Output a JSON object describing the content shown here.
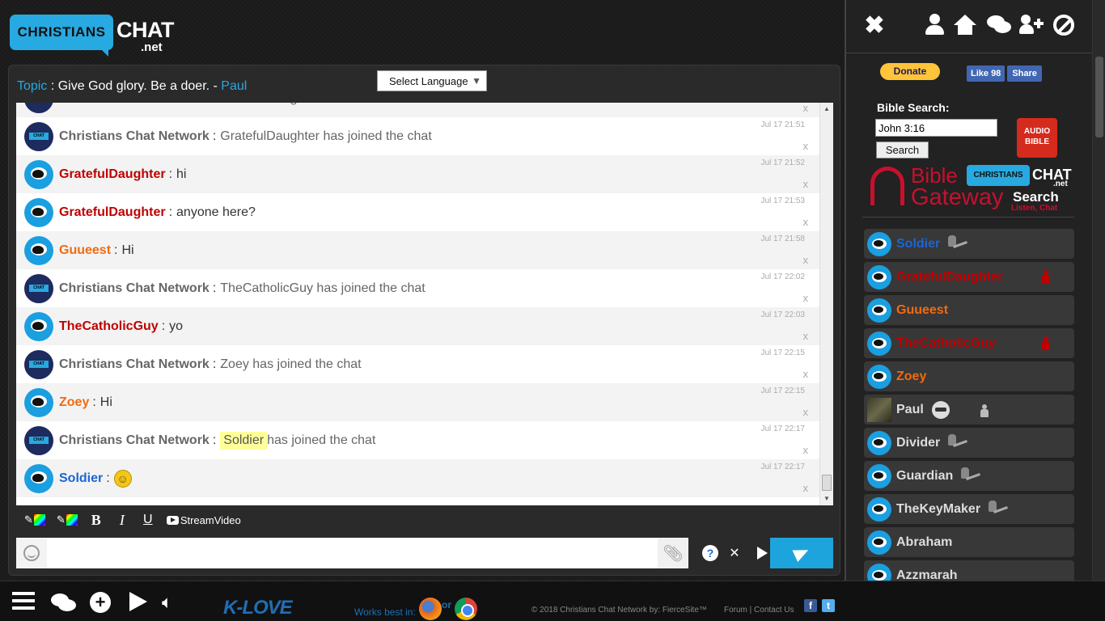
{
  "logo": {
    "box_text": "CHRISTIANS",
    "chat_text": "CHAT",
    "net_text": ".net"
  },
  "topic": {
    "label": "Topic",
    "separator": ":",
    "text": "Give God glory. Be a doer. - ",
    "author": "Paul"
  },
  "language_select": {
    "label": "Select Language",
    "arrow": "▼"
  },
  "messages": [
    {
      "avatar": "sys",
      "name": "Christians Chat Network",
      "name_color": "sys",
      "text": "GratefulDaughter has left the chat",
      "time": "",
      "system": true
    },
    {
      "avatar": "sys",
      "name": "Christians Chat Network",
      "name_color": "sys",
      "text": "GratefulDaughter has joined the chat",
      "time": "Jul 17 21:51",
      "system": true
    },
    {
      "avatar": "user",
      "name": "GratefulDaughter",
      "name_color": "red",
      "text": "hi",
      "time": "Jul 17 21:52",
      "system": false
    },
    {
      "avatar": "user",
      "name": "GratefulDaughter",
      "name_color": "red",
      "text": "anyone here?",
      "time": "Jul 17 21:53",
      "system": false
    },
    {
      "avatar": "user",
      "name": "Guueest",
      "name_color": "orange",
      "text": "Hi",
      "time": "Jul 17 21:58",
      "system": false
    },
    {
      "avatar": "sys",
      "name": "Christians Chat Network",
      "name_color": "sys",
      "text": "TheCatholicGuy has joined the chat",
      "time": "Jul 17 22:02",
      "system": true
    },
    {
      "avatar": "user",
      "name": "TheCatholicGuy",
      "name_color": "red",
      "text": "yo",
      "time": "Jul 17 22:03",
      "system": false
    },
    {
      "avatar": "sys",
      "name": "Christians Chat Network",
      "name_color": "sys",
      "text": "Zoey has joined the chat",
      "time": "Jul 17 22:15",
      "system": true
    },
    {
      "avatar": "user",
      "name": "Zoey",
      "name_color": "orange",
      "text": "Hi",
      "time": "Jul 17 22:15",
      "system": false
    },
    {
      "avatar": "sys",
      "name": "Christians Chat Network",
      "name_color": "sys",
      "highlight": "Soldier",
      "text": "has joined the chat",
      "time": "Jul 17 22:17",
      "system": true
    },
    {
      "avatar": "user",
      "name": "Soldier",
      "name_color": "blue",
      "text": "",
      "smiley": true,
      "time": "Jul 17 22:17",
      "system": false
    }
  ],
  "message_delete": "x",
  "format_bar": {
    "bold": "B",
    "italic": "I",
    "underline": "U",
    "stream_video": "StreamVideo"
  },
  "input": {
    "value": "",
    "placeholder": ""
  },
  "help_label": "?",
  "sidebar": {
    "close": "✖",
    "donate": "Donate",
    "fb_like": "Like 98",
    "fb_share": "Share",
    "bible_search_label": "Bible Search:",
    "bible_search_value": "John 3:16",
    "bible_search_button": "Search",
    "audio_bible": "AUDIO BIBLE",
    "bg_bible": "Bible",
    "bg_gateway": "Gateway",
    "bg_chat_box": "CHRISTIANS",
    "bg_chat": "CHAT",
    "bg_net": ".net",
    "bg_search": "Search",
    "bg_listen": "Listen, Chat",
    "users": [
      {
        "name": "Soldier",
        "color": "blue",
        "badge": "knight"
      },
      {
        "name": "GratefulDaughter",
        "color": "red",
        "badge": "person-red"
      },
      {
        "name": "Guueest",
        "color": "orange",
        "badge": ""
      },
      {
        "name": "TheCatholicGuy",
        "color": "red",
        "badge": "person-red"
      },
      {
        "name": "Zoey",
        "color": "orange",
        "badge": ""
      },
      {
        "name": "Paul",
        "color": "grey",
        "badge": "robot",
        "photo": true
      },
      {
        "name": "Divider",
        "color": "grey",
        "badge": "knight"
      },
      {
        "name": "Guardian",
        "color": "grey",
        "badge": "knight"
      },
      {
        "name": "TheKeyMaker",
        "color": "grey",
        "badge": "knight"
      },
      {
        "name": "Abraham",
        "color": "grey",
        "badge": ""
      },
      {
        "name": "Azzmarah",
        "color": "grey",
        "badge": ""
      }
    ]
  },
  "footer": {
    "klove": "K-LOVE",
    "works_best": "Works best in:",
    "or": "or",
    "copyright": "© 2018 Christians Chat Network by: FierceSite™",
    "links": "Forum | Contact Us",
    "fb": "f",
    "tw": "t"
  },
  "colors": {
    "accent": "#27a9e1",
    "send": "#1ea4dc",
    "red_name": "#c00000",
    "orange_name": "#f26a10",
    "blue_name": "#1a66d6"
  }
}
